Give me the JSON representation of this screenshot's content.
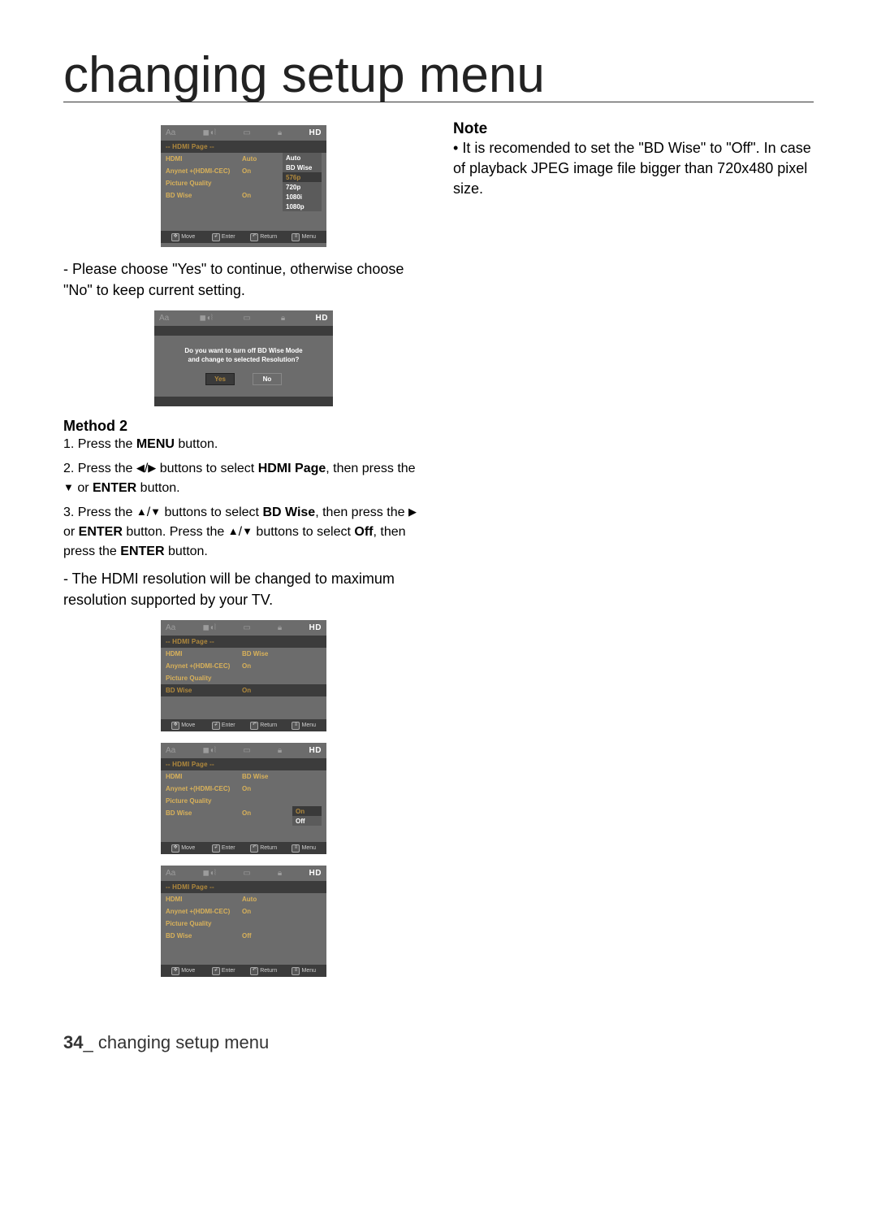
{
  "page": {
    "title": "changing setup menu",
    "footer_num": "34",
    "footer_sep": "_",
    "footer_text": "changing setup menu"
  },
  "left": {
    "instr1_prefix": "- ",
    "instr1": "Please choose \"Yes\" to continue, otherwise choose \"No\" to keep current setting.",
    "method_h": "Method 2",
    "s1_a": "1. Press the ",
    "s1_b": "MENU",
    "s1_c": " button.",
    "s2_a": "2. Press the ",
    "s2_tri1": "◀",
    "s2_slash": "/",
    "s2_tri2": "▶",
    "s2_b": " buttons to select ",
    "s2_bold": "HDMI Page",
    "s2_c": ", then press the ",
    "s2_tri3": "▼",
    "s2_d": " or ",
    "s2_bold2": "ENTER",
    "s2_e": " button.",
    "s3_a": "3. Press the ",
    "s3_tri1": "▲",
    "s3_slash": "/",
    "s3_tri2": "▼",
    "s3_b": " buttons to select ",
    "s3_bold": "BD Wise",
    "s3_c": ", then press the ",
    "s3_tri3": "▶",
    "s3_d": " or ",
    "s3_bold2": "ENTER",
    "s3_e": " button. Press the ",
    "s3_tri4": "▲",
    "s3_slash2": "/",
    "s3_tri5": "▼",
    "s3_f": " buttons to select ",
    "s3_bold3": "Off",
    "s3_g": ", then press the ",
    "s3_bold4": "ENTER",
    "s3_h": " button.",
    "result_prefix": "- ",
    "result": "The HDMI resolution will be changed to maximum resolution supported by your TV."
  },
  "right": {
    "note_h": "Note",
    "note_bullet": "• ",
    "note_body": "It is recomended to set the \"BD Wise\" to \"Off\". In case of playback JPEG image file bigger than 720x480 pixel size."
  },
  "osd_common": {
    "heading": "-- HDMI Page --",
    "l_hdmi": "HDMI",
    "l_anynet": "Anynet +(HDMI-CEC)",
    "l_pq": "Picture Quality",
    "l_bdwise": "BD Wise",
    "f_move": "Move",
    "f_enter": "Enter",
    "f_return": "Return",
    "f_menu": "Menu",
    "hd_label": "HD",
    "aa_label": "Aa"
  },
  "osd1": {
    "hdmi_val1": "Auto",
    "hdmi_val2": "Auto",
    "anynet_val": "On",
    "anynet_val2": "BD Wise",
    "bdwise_val": "On",
    "opts": [
      "Auto",
      "BD Wise",
      "576p",
      "720p",
      "1080i",
      "1080p"
    ],
    "sel_idx": 2
  },
  "osd_dialog": {
    "line1": "Do you want to turn off BD Wise Mode",
    "line2": "and change to selected Resolution?",
    "yes": "Yes",
    "no": "No"
  },
  "osd3": {
    "hdmi_val": "BD Wise",
    "anynet_val": "On",
    "bdwise_val": "On"
  },
  "osd4": {
    "hdmi_val": "BD Wise",
    "anynet_val": "On",
    "bdwise_val": "On",
    "opts": [
      "On",
      "Off"
    ],
    "sel_idx": 0
  },
  "osd5": {
    "hdmi_val": "Auto",
    "anynet_val": "On",
    "bdwise_val": "Off"
  }
}
